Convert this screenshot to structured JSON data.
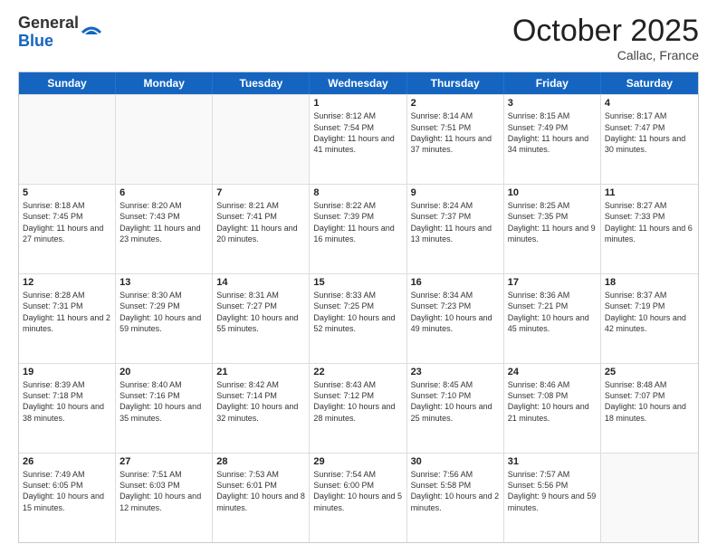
{
  "logo": {
    "general": "General",
    "blue": "Blue"
  },
  "header": {
    "month": "October 2025",
    "location": "Callac, France"
  },
  "weekdays": [
    "Sunday",
    "Monday",
    "Tuesday",
    "Wednesday",
    "Thursday",
    "Friday",
    "Saturday"
  ],
  "weeks": [
    [
      {
        "day": "",
        "sunrise": "",
        "sunset": "",
        "daylight": "",
        "empty": true
      },
      {
        "day": "",
        "sunrise": "",
        "sunset": "",
        "daylight": "",
        "empty": true
      },
      {
        "day": "",
        "sunrise": "",
        "sunset": "",
        "daylight": "",
        "empty": true
      },
      {
        "day": "1",
        "sunrise": "Sunrise: 8:12 AM",
        "sunset": "Sunset: 7:54 PM",
        "daylight": "Daylight: 11 hours and 41 minutes.",
        "empty": false
      },
      {
        "day": "2",
        "sunrise": "Sunrise: 8:14 AM",
        "sunset": "Sunset: 7:51 PM",
        "daylight": "Daylight: 11 hours and 37 minutes.",
        "empty": false
      },
      {
        "day": "3",
        "sunrise": "Sunrise: 8:15 AM",
        "sunset": "Sunset: 7:49 PM",
        "daylight": "Daylight: 11 hours and 34 minutes.",
        "empty": false
      },
      {
        "day": "4",
        "sunrise": "Sunrise: 8:17 AM",
        "sunset": "Sunset: 7:47 PM",
        "daylight": "Daylight: 11 hours and 30 minutes.",
        "empty": false
      }
    ],
    [
      {
        "day": "5",
        "sunrise": "Sunrise: 8:18 AM",
        "sunset": "Sunset: 7:45 PM",
        "daylight": "Daylight: 11 hours and 27 minutes.",
        "empty": false
      },
      {
        "day": "6",
        "sunrise": "Sunrise: 8:20 AM",
        "sunset": "Sunset: 7:43 PM",
        "daylight": "Daylight: 11 hours and 23 minutes.",
        "empty": false
      },
      {
        "day": "7",
        "sunrise": "Sunrise: 8:21 AM",
        "sunset": "Sunset: 7:41 PM",
        "daylight": "Daylight: 11 hours and 20 minutes.",
        "empty": false
      },
      {
        "day": "8",
        "sunrise": "Sunrise: 8:22 AM",
        "sunset": "Sunset: 7:39 PM",
        "daylight": "Daylight: 11 hours and 16 minutes.",
        "empty": false
      },
      {
        "day": "9",
        "sunrise": "Sunrise: 8:24 AM",
        "sunset": "Sunset: 7:37 PM",
        "daylight": "Daylight: 11 hours and 13 minutes.",
        "empty": false
      },
      {
        "day": "10",
        "sunrise": "Sunrise: 8:25 AM",
        "sunset": "Sunset: 7:35 PM",
        "daylight": "Daylight: 11 hours and 9 minutes.",
        "empty": false
      },
      {
        "day": "11",
        "sunrise": "Sunrise: 8:27 AM",
        "sunset": "Sunset: 7:33 PM",
        "daylight": "Daylight: 11 hours and 6 minutes.",
        "empty": false
      }
    ],
    [
      {
        "day": "12",
        "sunrise": "Sunrise: 8:28 AM",
        "sunset": "Sunset: 7:31 PM",
        "daylight": "Daylight: 11 hours and 2 minutes.",
        "empty": false
      },
      {
        "day": "13",
        "sunrise": "Sunrise: 8:30 AM",
        "sunset": "Sunset: 7:29 PM",
        "daylight": "Daylight: 10 hours and 59 minutes.",
        "empty": false
      },
      {
        "day": "14",
        "sunrise": "Sunrise: 8:31 AM",
        "sunset": "Sunset: 7:27 PM",
        "daylight": "Daylight: 10 hours and 55 minutes.",
        "empty": false
      },
      {
        "day": "15",
        "sunrise": "Sunrise: 8:33 AM",
        "sunset": "Sunset: 7:25 PM",
        "daylight": "Daylight: 10 hours and 52 minutes.",
        "empty": false
      },
      {
        "day": "16",
        "sunrise": "Sunrise: 8:34 AM",
        "sunset": "Sunset: 7:23 PM",
        "daylight": "Daylight: 10 hours and 49 minutes.",
        "empty": false
      },
      {
        "day": "17",
        "sunrise": "Sunrise: 8:36 AM",
        "sunset": "Sunset: 7:21 PM",
        "daylight": "Daylight: 10 hours and 45 minutes.",
        "empty": false
      },
      {
        "day": "18",
        "sunrise": "Sunrise: 8:37 AM",
        "sunset": "Sunset: 7:19 PM",
        "daylight": "Daylight: 10 hours and 42 minutes.",
        "empty": false
      }
    ],
    [
      {
        "day": "19",
        "sunrise": "Sunrise: 8:39 AM",
        "sunset": "Sunset: 7:18 PM",
        "daylight": "Daylight: 10 hours and 38 minutes.",
        "empty": false
      },
      {
        "day": "20",
        "sunrise": "Sunrise: 8:40 AM",
        "sunset": "Sunset: 7:16 PM",
        "daylight": "Daylight: 10 hours and 35 minutes.",
        "empty": false
      },
      {
        "day": "21",
        "sunrise": "Sunrise: 8:42 AM",
        "sunset": "Sunset: 7:14 PM",
        "daylight": "Daylight: 10 hours and 32 minutes.",
        "empty": false
      },
      {
        "day": "22",
        "sunrise": "Sunrise: 8:43 AM",
        "sunset": "Sunset: 7:12 PM",
        "daylight": "Daylight: 10 hours and 28 minutes.",
        "empty": false
      },
      {
        "day": "23",
        "sunrise": "Sunrise: 8:45 AM",
        "sunset": "Sunset: 7:10 PM",
        "daylight": "Daylight: 10 hours and 25 minutes.",
        "empty": false
      },
      {
        "day": "24",
        "sunrise": "Sunrise: 8:46 AM",
        "sunset": "Sunset: 7:08 PM",
        "daylight": "Daylight: 10 hours and 21 minutes.",
        "empty": false
      },
      {
        "day": "25",
        "sunrise": "Sunrise: 8:48 AM",
        "sunset": "Sunset: 7:07 PM",
        "daylight": "Daylight: 10 hours and 18 minutes.",
        "empty": false
      }
    ],
    [
      {
        "day": "26",
        "sunrise": "Sunrise: 7:49 AM",
        "sunset": "Sunset: 6:05 PM",
        "daylight": "Daylight: 10 hours and 15 minutes.",
        "empty": false
      },
      {
        "day": "27",
        "sunrise": "Sunrise: 7:51 AM",
        "sunset": "Sunset: 6:03 PM",
        "daylight": "Daylight: 10 hours and 12 minutes.",
        "empty": false
      },
      {
        "day": "28",
        "sunrise": "Sunrise: 7:53 AM",
        "sunset": "Sunset: 6:01 PM",
        "daylight": "Daylight: 10 hours and 8 minutes.",
        "empty": false
      },
      {
        "day": "29",
        "sunrise": "Sunrise: 7:54 AM",
        "sunset": "Sunset: 6:00 PM",
        "daylight": "Daylight: 10 hours and 5 minutes.",
        "empty": false
      },
      {
        "day": "30",
        "sunrise": "Sunrise: 7:56 AM",
        "sunset": "Sunset: 5:58 PM",
        "daylight": "Daylight: 10 hours and 2 minutes.",
        "empty": false
      },
      {
        "day": "31",
        "sunrise": "Sunrise: 7:57 AM",
        "sunset": "Sunset: 5:56 PM",
        "daylight": "Daylight: 9 hours and 59 minutes.",
        "empty": false
      },
      {
        "day": "",
        "sunrise": "",
        "sunset": "",
        "daylight": "",
        "empty": true
      }
    ]
  ]
}
